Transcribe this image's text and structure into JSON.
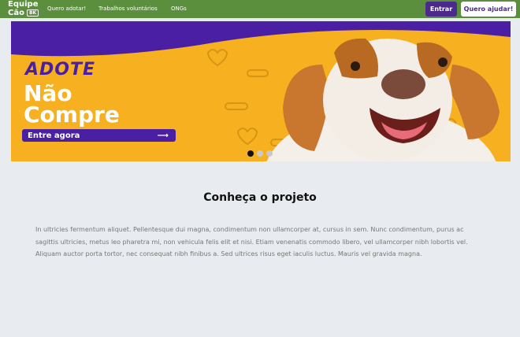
{
  "navbar": {
    "logo_line1": "Equipe",
    "logo_line2": "Cão",
    "logo_badge": "BK",
    "links": [
      "Quero adotar!",
      "Trabalhos voluntários",
      "ONGs"
    ],
    "login_label": "Entrar",
    "help_label": "Quero ajudar!"
  },
  "banner": {
    "kicker": "ADOTE",
    "headline_line1": "Não",
    "headline_line2": "Compre",
    "cta_label": "Entre agora",
    "cta_arrow": "⟶",
    "slide_count": 3,
    "active_slide": 1
  },
  "section": {
    "title": "Conheça o projeto",
    "body": "In ultricies fermentum aliquet. Pellentesque dui magna, condimentum non ullamcorper at, cursus in sem. Nunc condimentum, purus ac sagittis ultricies, metus leo pharetra mi, non vehicula felis elit et nisi. Etiam venenatis commodo libero, vel ullamcorper nibh lobortis vel. Aliquam auctor porta tortor, nec consequat nibh finibus a. Sed ultrices risus eget iaculis luctus. Mauris vel gravida magna."
  },
  "colors": {
    "navbar_bg": "#5b8f3d",
    "brand_purple": "#4b2a8c",
    "banner_yellow": "#f6b020",
    "page_bg": "#e8ebef"
  }
}
